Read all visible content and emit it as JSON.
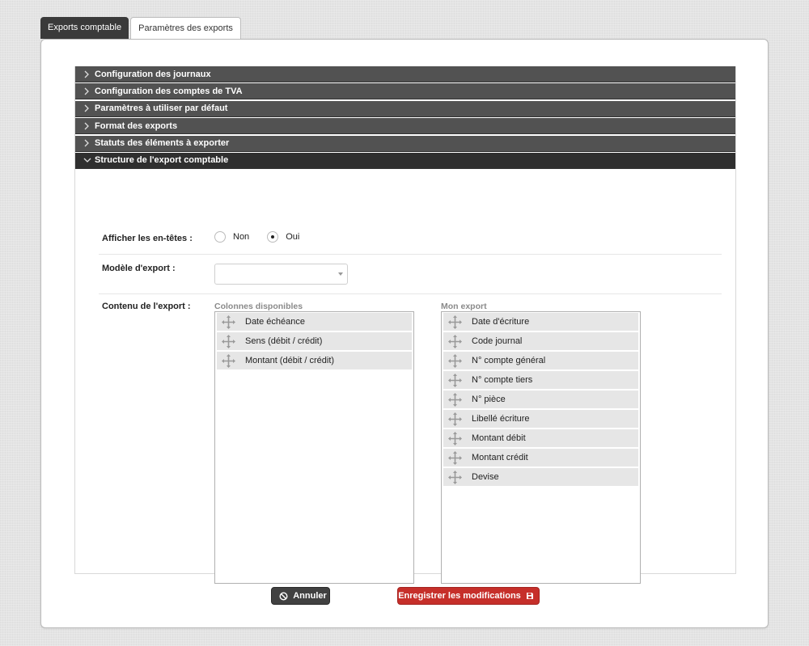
{
  "tabs": [
    {
      "label": "Exports comptable",
      "active": true
    },
    {
      "label": "Paramètres des exports",
      "active": false
    }
  ],
  "accordion": [
    {
      "label": "Configuration des journaux",
      "open": false
    },
    {
      "label": "Configuration des comptes de TVA",
      "open": false
    },
    {
      "label": "Paramètres à utiliser par défaut",
      "open": false
    },
    {
      "label": "Format des exports",
      "open": false
    },
    {
      "label": "Statuts des éléments à exporter",
      "open": false
    },
    {
      "label": "Structure de l'export comptable",
      "open": true
    }
  ],
  "form": {
    "headers_label": "Afficher les en-têtes :",
    "radio_no": "Non",
    "radio_yes": "Oui",
    "radio_selected": "Oui",
    "model_label": "Modèle d'export :",
    "model_value": "",
    "content_label": "Contenu de l'export :"
  },
  "available_columns": {
    "title": "Colonnes disponibles",
    "items": [
      "Date échéance",
      "Sens (débit / crédit)",
      "Montant (débit / crédit)"
    ]
  },
  "my_export": {
    "title": "Mon export",
    "items": [
      "Date d'écriture",
      "Code journal",
      "N° compte général",
      "N° compte tiers",
      "N° pièce",
      "Libellé écriture",
      "Montant débit",
      "Montant crédit",
      "Devise"
    ]
  },
  "buttons": {
    "cancel": "Annuler",
    "save": "Enregistrer les modifications"
  },
  "colors": {
    "save_button": "#c62f2a",
    "cancel_button": "#414141",
    "accordion_header": "#525252",
    "active_tab": "#3a3a3a"
  },
  "icons": {
    "accordion_closed": "chevron-right-icon",
    "accordion_open": "chevron-down-icon",
    "drag": "move-arrows-icon",
    "cancel": "ban-icon",
    "save": "floppy-disk-icon"
  }
}
